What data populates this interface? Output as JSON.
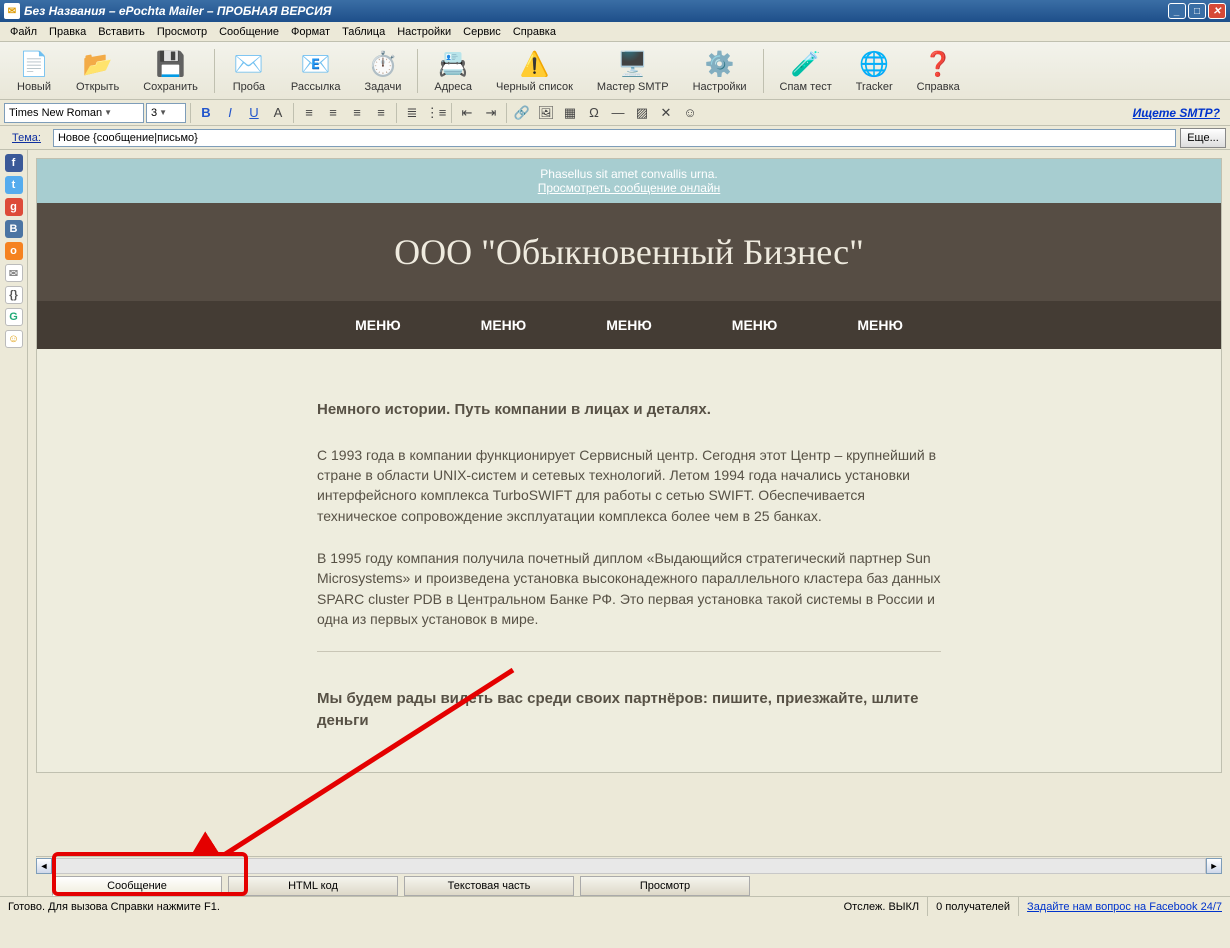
{
  "title": "Без Названия – ePochta Mailer – ПРОБНАЯ ВЕРСИЯ",
  "menu": [
    "Файл",
    "Правка",
    "Вставить",
    "Просмотр",
    "Сообщение",
    "Формат",
    "Таблица",
    "Настройки",
    "Сервис",
    "Справка"
  ],
  "toolbar": [
    {
      "label": "Новый",
      "icon": "📄",
      "name": "new-button"
    },
    {
      "label": "Открыть",
      "icon": "📂",
      "name": "open-button"
    },
    {
      "label": "Сохранить",
      "icon": "💾",
      "name": "save-button"
    },
    {
      "sep": true
    },
    {
      "label": "Проба",
      "icon": "✉️",
      "name": "test-button"
    },
    {
      "label": "Рассылка",
      "icon": "📧",
      "name": "send-button"
    },
    {
      "label": "Задачи",
      "icon": "⏱️",
      "name": "tasks-button"
    },
    {
      "sep": true
    },
    {
      "label": "Адреса",
      "icon": "📇",
      "name": "addresses-button"
    },
    {
      "label": "Черный список",
      "icon": "⚠️",
      "name": "blacklist-button"
    },
    {
      "label": "Мастер SMTP",
      "icon": "🖥️",
      "name": "smtp-wizard-button"
    },
    {
      "label": "Настройки",
      "icon": "⚙️",
      "name": "settings-button"
    },
    {
      "sep": true
    },
    {
      "label": "Спам тест",
      "icon": "🧪",
      "name": "spam-test-button"
    },
    {
      "label": "Tracker",
      "icon": "🌐",
      "name": "tracker-button"
    },
    {
      "label": "Справка",
      "icon": "❓",
      "name": "help-button"
    }
  ],
  "font": {
    "name": "Times New Roman",
    "size": "3"
  },
  "smtp_link": "Ищете SMTP?",
  "subject": {
    "label": "Тема:",
    "value": "Новое {сообщение|письмо}",
    "more": "Еще..."
  },
  "side_icons": [
    {
      "bg": "#3b5998",
      "txt": "f",
      "name": "facebook-icon"
    },
    {
      "bg": "#55acee",
      "txt": "t",
      "name": "twitter-icon"
    },
    {
      "bg": "#dd4b39",
      "txt": "g",
      "name": "google-plus-icon"
    },
    {
      "bg": "#4c75a3",
      "txt": "B",
      "name": "vk-icon"
    },
    {
      "bg": "#f58220",
      "txt": "o",
      "name": "odnoklassniki-icon"
    },
    {
      "bg": "#ffffff",
      "txt": "✉",
      "name": "mail-icon",
      "color": "#888"
    },
    {
      "bg": "#ffffff",
      "txt": "{}",
      "name": "code-icon",
      "color": "#555"
    },
    {
      "bg": "#ffffff",
      "txt": "G",
      "name": "google-icon",
      "color": "#2a7"
    },
    {
      "bg": "#ffffff",
      "txt": "☺",
      "name": "emoji-icon",
      "color": "#d90"
    }
  ],
  "email": {
    "banner1": "Phasellus sit amet convallis urna.",
    "banner2": "Просмотреть сообщение онлайн",
    "title": "ООО \"Обыкновенный Бизнес\"",
    "nav": [
      "МЕНЮ",
      "МЕНЮ",
      "МЕНЮ",
      "МЕНЮ",
      "МЕНЮ"
    ],
    "h3": "Немного истории. Путь компании в лицах и деталях.",
    "p1": "С 1993 года в компании функционирует Сервисный центр. Сегодня этот Центр – крупнейший в стране в области UNIX-систем и сетевых технологий. Летом 1994 года начались установки интерфейсного комплекса TurboSWIFT для работы с сетью SWIFT. Обеспечивается техническое сопровождение эксплуатации комплекса более чем в 25 банках.",
    "p2": "В 1995 году компания получила почетный диплом «Выдающийся стратегический партнер Sun Microsystems» и произведена установка высоконадежного параллельного кластера баз данных SPARC cluster PDB в Центральном Банке РФ. Это первая установка такой системы в России и одна из первых установок в мире.",
    "h4": "Мы будем рады видеть вас среди своих партнёров: пишите, приезжайте, шлите деньги"
  },
  "tabs": [
    "Сообщение",
    "HTML код",
    "Текстовая часть",
    "Просмотр"
  ],
  "status": {
    "ready": "Готово. Для вызова Справки нажмите F1.",
    "track": "Отслеж. ВЫКЛ",
    "recip": "0 получателей",
    "fb": "Задайте нам вопрос на Facebook 24/7"
  }
}
